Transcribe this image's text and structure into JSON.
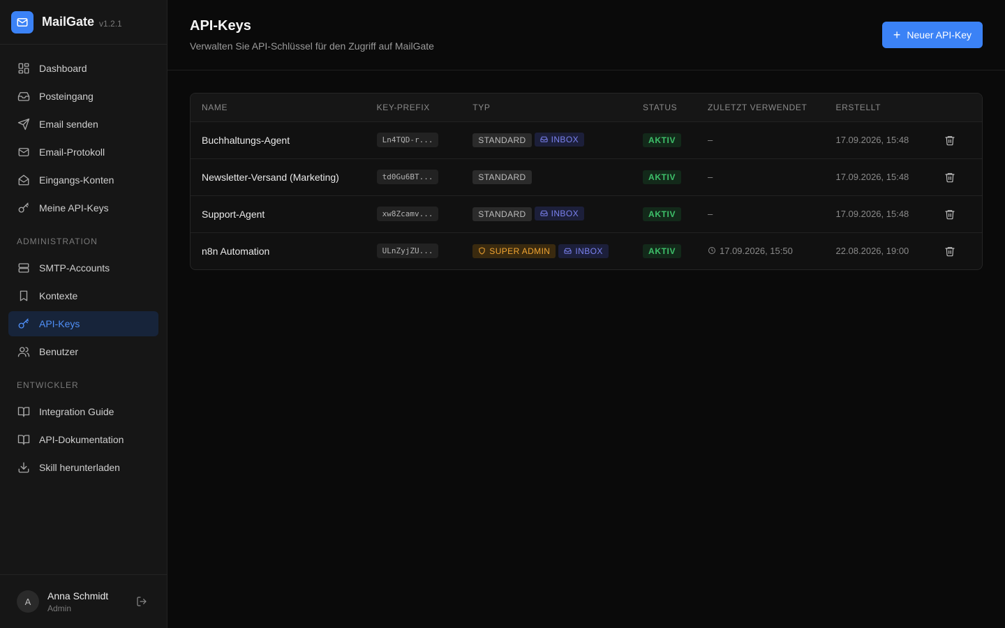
{
  "brand": {
    "name": "MailGate",
    "version": "v1.2.1"
  },
  "nav": {
    "main": [
      {
        "label": "Dashboard",
        "icon": "grid-icon"
      },
      {
        "label": "Posteingang",
        "icon": "inbox-icon"
      },
      {
        "label": "Email senden",
        "icon": "send-icon"
      },
      {
        "label": "Email-Protokoll",
        "icon": "mail-icon"
      },
      {
        "label": "Eingangs-Konten",
        "icon": "mail-open-icon"
      },
      {
        "label": "Meine API-Keys",
        "icon": "key-icon"
      }
    ],
    "admin_title": "ADMINISTRATION",
    "admin": [
      {
        "label": "SMTP-Accounts",
        "icon": "server-icon"
      },
      {
        "label": "Kontexte",
        "icon": "bookmark-icon"
      },
      {
        "label": "API-Keys",
        "icon": "key-icon",
        "active": true
      },
      {
        "label": "Benutzer",
        "icon": "users-icon"
      }
    ],
    "dev_title": "ENTWICKLER",
    "dev": [
      {
        "label": "Integration Guide",
        "icon": "book-icon"
      },
      {
        "label": "API-Dokumentation",
        "icon": "book-icon"
      },
      {
        "label": "Skill herunterladen",
        "icon": "download-icon"
      }
    ]
  },
  "user": {
    "initial": "A",
    "name": "Anna Schmidt",
    "role": "Admin"
  },
  "header": {
    "title": "API-Keys",
    "subtitle": "Verwalten Sie API-Schlüssel für den Zugriff auf MailGate",
    "new_button": "Neuer API-Key"
  },
  "table": {
    "columns": [
      "NAME",
      "KEY-PREFIX",
      "TYP",
      "STATUS",
      "ZULETZT VERWENDET",
      "ERSTELLT"
    ],
    "rows": [
      {
        "name": "Buchhaltungs-Agent",
        "prefix": "Ln4TQD-r...",
        "type": "STANDARD",
        "inbox": "INBOX",
        "status": "AKTIV",
        "last_used": "–",
        "created": "17.09.2026, 15:48"
      },
      {
        "name": "Newsletter-Versand (Marketing)",
        "prefix": "td0Gu6BT...",
        "type": "STANDARD",
        "inbox": "",
        "status": "AKTIV",
        "last_used": "–",
        "created": "17.09.2026, 15:48"
      },
      {
        "name": "Support-Agent",
        "prefix": "xw8Zcamv...",
        "type": "STANDARD",
        "inbox": "INBOX",
        "status": "AKTIV",
        "last_used": "–",
        "created": "17.09.2026, 15:48"
      },
      {
        "name": "n8n Automation",
        "prefix": "ULnZyjZU...",
        "type": "SUPER ADMIN",
        "inbox": "INBOX",
        "status": "AKTIV",
        "last_used": "17.09.2026, 15:50",
        "created": "22.08.2026, 19:00"
      }
    ]
  },
  "colors": {
    "accent": "#3b82f6",
    "status_active": "#3ec06a",
    "super_admin": "#f2a531",
    "inbox": "#7b82f0"
  }
}
